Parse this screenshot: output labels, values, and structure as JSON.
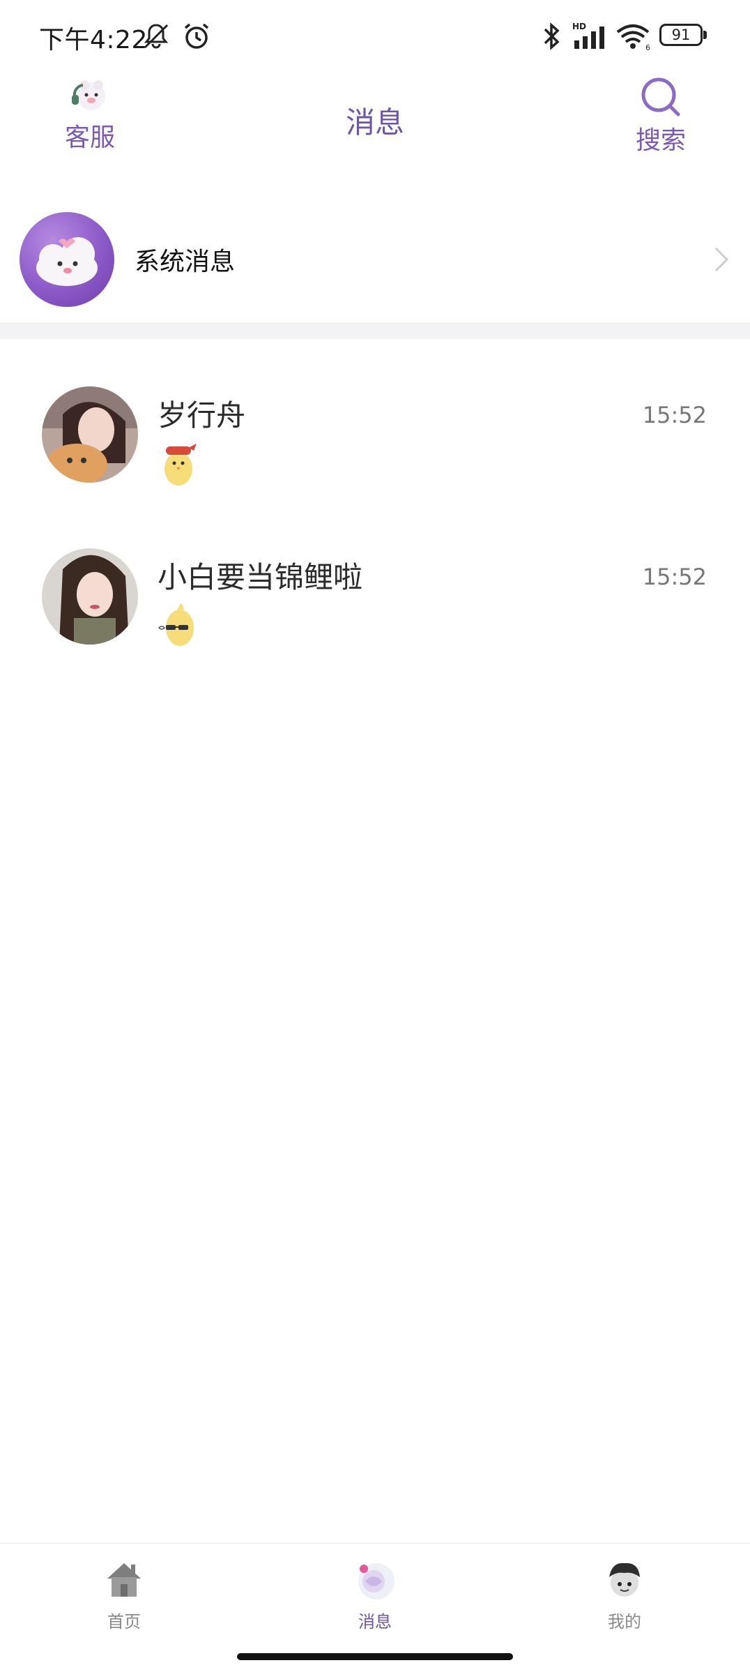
{
  "status_bar": {
    "time": "下午4:22",
    "battery": "91",
    "network_label": "HD",
    "wifi_label": "6",
    "icons": [
      "mute-bell-icon",
      "alarm-icon",
      "bluetooth-icon",
      "signal-icon",
      "wifi-icon",
      "battery-icon"
    ]
  },
  "header": {
    "title": "消息",
    "left_button": {
      "label": "客服",
      "icon": "customer-service-icon"
    },
    "right_button": {
      "label": "搜索",
      "icon": "search-icon"
    }
  },
  "system_message": {
    "label": "系统消息",
    "icon": "cloud-mascot-icon"
  },
  "chats": [
    {
      "name": "岁行舟",
      "time": "15:52",
      "preview": "chick-sticker-red-hat"
    },
    {
      "name": "小白要当锦鲤啦",
      "time": "15:52",
      "preview": "chick-sticker-glasses"
    }
  ],
  "tabs": [
    {
      "label": "首页",
      "icon": "house-icon",
      "active": false
    },
    {
      "label": "消息",
      "icon": "message-bubble-icon",
      "active": true
    },
    {
      "label": "我的",
      "icon": "profile-avatar-icon",
      "active": false
    }
  ],
  "colors": {
    "accent": "#6f55a8",
    "accent_light": "#8c5ac8",
    "text_secondary": "#777777",
    "divider": "#f3f2f5"
  }
}
